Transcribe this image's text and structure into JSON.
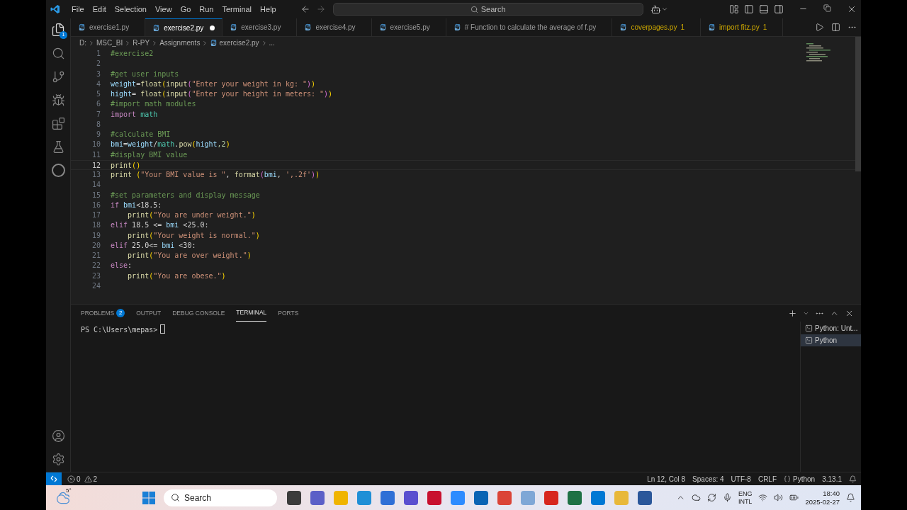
{
  "menu": [
    "File",
    "Edit",
    "Selection",
    "View",
    "Go",
    "Run",
    "Terminal",
    "Help"
  ],
  "search": {
    "placeholder": "Search"
  },
  "activity_badge": "1",
  "tabs": [
    {
      "label": "exercise1.py",
      "selected": false,
      "modified": false,
      "kind": "normal"
    },
    {
      "label": "exercise2.py",
      "selected": true,
      "modified": true,
      "kind": "normal"
    },
    {
      "label": "exercise3.py",
      "selected": false,
      "modified": false,
      "kind": "normal"
    },
    {
      "label": "exercise4.py",
      "selected": false,
      "modified": false,
      "kind": "normal"
    },
    {
      "label": "exercise5.py",
      "selected": false,
      "modified": false,
      "kind": "normal"
    },
    {
      "label": "# Function to calculate the average of f.py",
      "selected": false,
      "modified": false,
      "kind": "normal"
    },
    {
      "label": "coverpages.py",
      "selected": false,
      "modified": false,
      "kind": "warning",
      "count": "1"
    },
    {
      "label": "import fitz.py",
      "selected": false,
      "modified": false,
      "kind": "warning",
      "count": "1"
    }
  ],
  "breadcrumb": [
    "D:",
    "MSC_BI",
    "R-PY",
    "Assignments",
    "exercise2.py",
    "..."
  ],
  "code": [
    {
      "number": "1",
      "selected": false,
      "tokens": [
        {
          "text": "#exercise2",
          "kind": "comment"
        }
      ]
    },
    {
      "number": "2",
      "selected": false
    },
    {
      "number": "3",
      "selected": false,
      "tokens": [
        {
          "text": "#get user inputs",
          "kind": "comment"
        }
      ]
    },
    {
      "number": "4",
      "selected": false,
      "tokens": [
        {
          "text": "weight",
          "kind": "var"
        },
        {
          "text": "=",
          "kind": "plain"
        },
        {
          "text": "float",
          "kind": "fn"
        },
        {
          "text": "(",
          "kind": "p1"
        },
        {
          "text": "input",
          "kind": "fn"
        },
        {
          "text": "(",
          "kind": "p2"
        },
        {
          "text": "\"Enter your weight in kg: \"",
          "kind": "str"
        },
        {
          "text": ")",
          "kind": "p2"
        },
        {
          "text": ")",
          "kind": "p1"
        }
      ]
    },
    {
      "number": "5",
      "selected": false,
      "tokens": [
        {
          "text": "hight",
          "kind": "var"
        },
        {
          "text": "= ",
          "kind": "plain"
        },
        {
          "text": "float",
          "kind": "fn"
        },
        {
          "text": "(",
          "kind": "p1"
        },
        {
          "text": "input",
          "kind": "fn"
        },
        {
          "text": "(",
          "kind": "p2"
        },
        {
          "text": "\"Enter your height in meters: \"",
          "kind": "str"
        },
        {
          "text": ")",
          "kind": "p2"
        },
        {
          "text": ")",
          "kind": "p1"
        }
      ]
    },
    {
      "number": "6",
      "selected": false,
      "tokens": [
        {
          "text": "#import math modules",
          "kind": "comment"
        }
      ]
    },
    {
      "number": "7",
      "selected": false,
      "tokens": [
        {
          "text": "import",
          "kind": "kw"
        },
        {
          "text": " math",
          "kind": "mod"
        }
      ]
    },
    {
      "number": "8",
      "selected": false
    },
    {
      "number": "9",
      "selected": false,
      "tokens": [
        {
          "text": "#calculate BMI",
          "kind": "comment"
        }
      ]
    },
    {
      "number": "10",
      "selected": false,
      "tokens": [
        {
          "text": "bmi",
          "kind": "var"
        },
        {
          "text": "=",
          "kind": "plain"
        },
        {
          "text": "weight",
          "kind": "var"
        },
        {
          "text": "/",
          "kind": "plain"
        },
        {
          "text": "math",
          "kind": "mod"
        },
        {
          "text": ".",
          "kind": "plain"
        },
        {
          "text": "pow",
          "kind": "fn"
        },
        {
          "text": "(",
          "kind": "p1"
        },
        {
          "text": "hight",
          "kind": "var"
        },
        {
          "text": ",2",
          "kind": "num"
        },
        {
          "text": ")",
          "kind": "p1"
        }
      ]
    },
    {
      "number": "11",
      "selected": false,
      "tokens": [
        {
          "text": "#display BMI value",
          "kind": "comment"
        }
      ]
    },
    {
      "number": "12",
      "selected": true,
      "tokens": [
        {
          "text": "print",
          "kind": "fn"
        },
        {
          "text": "()",
          "kind": "p1"
        }
      ]
    },
    {
      "number": "13",
      "selected": false,
      "tokens": [
        {
          "text": "print ",
          "kind": "fn"
        },
        {
          "text": "(",
          "kind": "p1"
        },
        {
          "text": "\"Your BMI value is \"",
          "kind": "str"
        },
        {
          "text": ", ",
          "kind": "plain"
        },
        {
          "text": "format",
          "kind": "fn"
        },
        {
          "text": "(",
          "kind": "p2"
        },
        {
          "text": "bmi",
          "kind": "var"
        },
        {
          "text": ", ",
          "kind": "plain"
        },
        {
          "text": "',.2f'",
          "kind": "str"
        },
        {
          "text": ")",
          "kind": "p2"
        },
        {
          "text": ")",
          "kind": "p1"
        }
      ]
    },
    {
      "number": "14",
      "selected": false
    },
    {
      "number": "15",
      "selected": false,
      "tokens": [
        {
          "text": "#set parameters and display message",
          "kind": "comment"
        }
      ]
    },
    {
      "number": "16",
      "selected": false,
      "tokens": [
        {
          "text": "if ",
          "kind": "kw"
        },
        {
          "text": "bmi",
          "kind": "var"
        },
        {
          "text": "<18.5:",
          "kind": "plain"
        }
      ]
    },
    {
      "number": "17",
      "selected": false,
      "tokens": [
        {
          "text": "    print",
          "kind": "fn"
        },
        {
          "text": "(",
          "kind": "p1"
        },
        {
          "text": "\"You are under weight.\"",
          "kind": "str"
        },
        {
          "text": ")",
          "kind": "p1"
        }
      ]
    },
    {
      "number": "18",
      "selected": false,
      "tokens": [
        {
          "text": "elif ",
          "kind": "kw"
        },
        {
          "text": "18.5 <= ",
          "kind": "plain"
        },
        {
          "text": "bmi",
          "kind": "var"
        },
        {
          "text": " <25.0:",
          "kind": "plain"
        }
      ]
    },
    {
      "number": "19",
      "selected": false,
      "tokens": [
        {
          "text": "    print",
          "kind": "fn"
        },
        {
          "text": "(",
          "kind": "p1"
        },
        {
          "text": "\"Your weight is normal.\"",
          "kind": "str"
        },
        {
          "text": ")",
          "kind": "p1"
        }
      ]
    },
    {
      "number": "20",
      "selected": false,
      "tokens": [
        {
          "text": "elif ",
          "kind": "kw"
        },
        {
          "text": "25.0<= ",
          "kind": "plain"
        },
        {
          "text": "bmi",
          "kind": "var"
        },
        {
          "text": " <30:",
          "kind": "plain"
        }
      ]
    },
    {
      "number": "21",
      "selected": false,
      "tokens": [
        {
          "text": "    print",
          "kind": "fn"
        },
        {
          "text": "(",
          "kind": "p1"
        },
        {
          "text": "\"You are over weight.\"",
          "kind": "str"
        },
        {
          "text": ")",
          "kind": "p1"
        }
      ]
    },
    {
      "number": "22",
      "selected": false,
      "tokens": [
        {
          "text": "else",
          "kind": "kw"
        },
        {
          "text": ":",
          "kind": "plain"
        }
      ]
    },
    {
      "number": "23",
      "selected": false,
      "tokens": [
        {
          "text": "    print",
          "kind": "fn"
        },
        {
          "text": "(",
          "kind": "p1"
        },
        {
          "text": "\"You are obese.\"",
          "kind": "str"
        },
        {
          "text": ")",
          "kind": "p1"
        }
      ]
    },
    {
      "number": "24",
      "selected": false
    }
  ],
  "panel_tabs": [
    {
      "label": "PROBLEMS",
      "selected": false,
      "count": "2"
    },
    {
      "label": "OUTPUT",
      "selected": false
    },
    {
      "label": "DEBUG CONSOLE",
      "selected": false
    },
    {
      "label": "TERMINAL",
      "selected": true
    },
    {
      "label": "PORTS",
      "selected": false
    }
  ],
  "terminal": {
    "prompt": "PS C:\\Users\\mepas>"
  },
  "terminal_list": [
    {
      "label": "Python: Unt...",
      "selected": false
    },
    {
      "label": "Python",
      "selected": true
    }
  ],
  "status_bar": {
    "errors": "0",
    "warnings": "2",
    "items": [
      "Ln 12, Col 8",
      "Spaces: 4",
      "UTF-8",
      "CRLF",
      "Python",
      "3.13.1"
    ]
  },
  "taskbar": {
    "weather": "5°",
    "search": "Search",
    "language": [
      "ENG",
      "INTL"
    ],
    "time": "18:40",
    "date": "2025-02-27"
  }
}
